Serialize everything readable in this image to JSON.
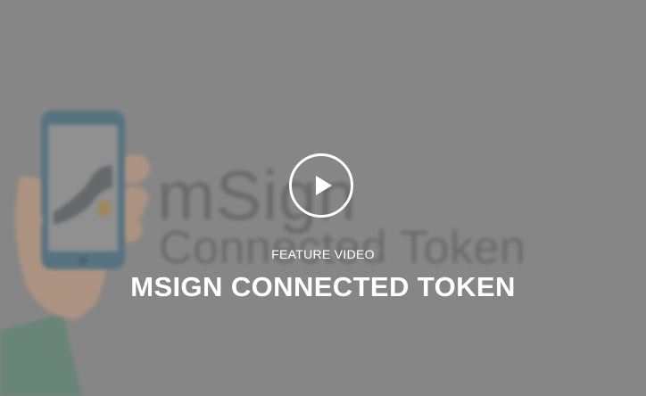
{
  "video": {
    "kicker": "FEATURE VIDEO",
    "title": "MSIGN CONNECTED TOKEN",
    "play_icon": "play-icon"
  },
  "thumbnail": {
    "brand_text": "mSign",
    "product_text": "Connected Token",
    "phone_icon": "smartphone-icon",
    "hand_icon": "hand-icon"
  },
  "colors": {
    "overlay": "#8c8c8c",
    "phone_frame": "#3f6c83",
    "sleeve": "#5b8a74",
    "skin": "#c9a083",
    "text": "#ffffff"
  }
}
